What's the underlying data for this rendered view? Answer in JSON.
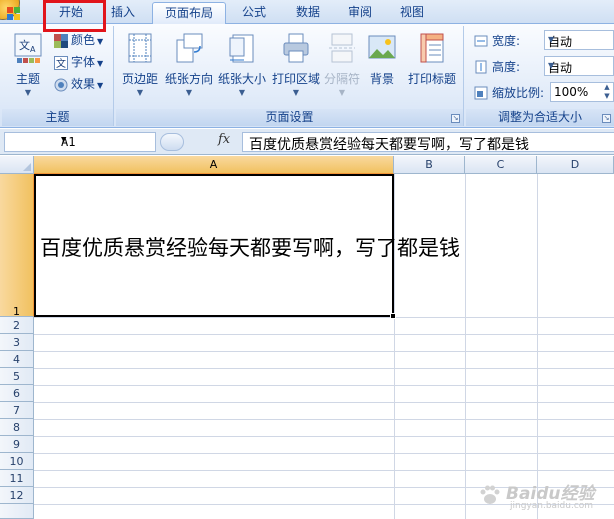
{
  "tabs": [
    {
      "label": "开始",
      "active": false
    },
    {
      "label": "插入",
      "active": false
    },
    {
      "label": "页面布局",
      "active": true
    },
    {
      "label": "公式",
      "active": false
    },
    {
      "label": "数据",
      "active": false
    },
    {
      "label": "审阅",
      "active": false
    },
    {
      "label": "视图",
      "active": false
    }
  ],
  "ribbon": {
    "theme_group": {
      "label": "主题",
      "themes_button": "主题",
      "colors_button": "颜色",
      "fonts_button": "字体",
      "effects_button": "效果"
    },
    "page_setup_group": {
      "label": "页面设置",
      "buttons": [
        {
          "label": "页边距",
          "icon": "margins-icon",
          "enabled": true
        },
        {
          "label": "纸张方向",
          "icon": "orientation-icon",
          "enabled": true
        },
        {
          "label": "纸张大小",
          "icon": "paper-size-icon",
          "enabled": true
        },
        {
          "label": "打印区域",
          "icon": "print-area-icon",
          "enabled": true
        },
        {
          "label": "分隔符",
          "icon": "breaks-icon",
          "enabled": false
        },
        {
          "label": "背景",
          "icon": "background-icon",
          "enabled": true
        },
        {
          "label": "打印标题",
          "icon": "print-titles-icon",
          "enabled": true
        }
      ]
    },
    "scale_group": {
      "label": "调整为合适大小",
      "width_label": "宽度:",
      "width_value": "自动",
      "height_label": "高度:",
      "height_value": "自动",
      "scale_label": "缩放比例:",
      "scale_value": "100%"
    }
  },
  "formula_bar": {
    "name_box": "A1",
    "fx": "fx",
    "content": "百度优质悬赏经验每天都要写啊，写了都是钱"
  },
  "sheet": {
    "columns": [
      "A",
      "B",
      "C",
      "D"
    ],
    "rows": [
      "1",
      "2",
      "3",
      "4",
      "5",
      "6",
      "7",
      "8",
      "9",
      "10",
      "11",
      "12"
    ],
    "selected_cell": "A1",
    "cell_a1": "百度优质悬赏经验每天都要写啊，写了都是钱"
  },
  "watermark": {
    "brand": "Baidu经验",
    "url": "jingyan.baidu.com"
  },
  "colors": {
    "highlight_box": "#e1141b",
    "selected_header": "#f1c15f"
  }
}
